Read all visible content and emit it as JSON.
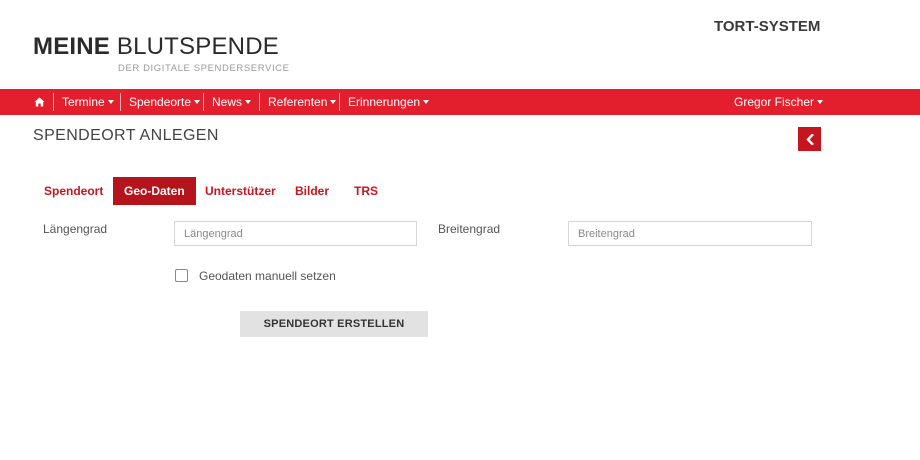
{
  "header": {
    "logo_bold": "MEINE",
    "logo_light": "BLUTSPENDE",
    "logo_sub": "DER DIGITALE SPENDERSERVICE",
    "system_name": "TORT-SYSTEM"
  },
  "nav": {
    "home_icon": "home-icon",
    "items": [
      {
        "label": "Termine"
      },
      {
        "label": "Spendeorte"
      },
      {
        "label": "News"
      },
      {
        "label": "Referenten"
      },
      {
        "label": "Erinnerungen"
      }
    ],
    "user": "Gregor Fischer"
  },
  "page": {
    "title": "SPENDEORT ANLEGEN",
    "back_icon": "chevron-left-icon"
  },
  "tabs": [
    {
      "label": "Spendeort",
      "active": false
    },
    {
      "label": "Geo-Daten",
      "active": true
    },
    {
      "label": "Unterstützer",
      "active": false
    },
    {
      "label": "Bilder",
      "active": false
    },
    {
      "label": "TRS",
      "active": false
    }
  ],
  "form": {
    "longitude_label": "Längengrad",
    "longitude_placeholder": "Längengrad",
    "longitude_value": "",
    "latitude_label": "Breitengrad",
    "latitude_placeholder": "Breitengrad",
    "latitude_value": "",
    "manual_geodata_label": "Geodaten manuell setzen",
    "manual_geodata_checked": false,
    "submit_label": "SPENDEORT ERSTELLEN"
  },
  "colors": {
    "brand_red": "#e41f2d",
    "active_tab": "#b5141d",
    "tab_text": "#c5161f"
  }
}
